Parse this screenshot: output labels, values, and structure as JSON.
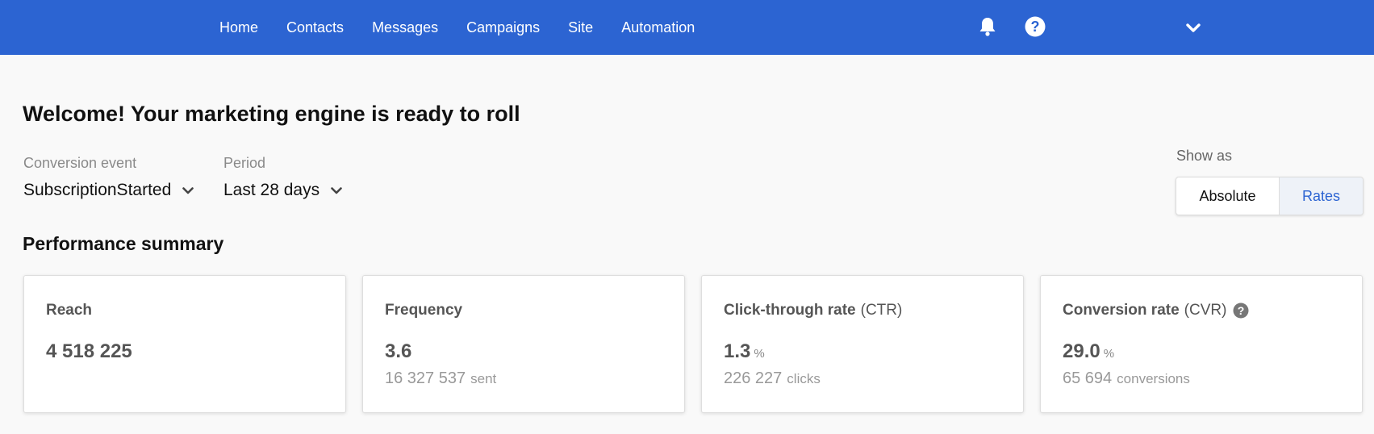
{
  "nav": {
    "items": [
      "Home",
      "Contacts",
      "Messages",
      "Campaigns",
      "Site",
      "Automation"
    ],
    "icons": [
      "bell-icon",
      "help-icon",
      "chevron-down-icon"
    ]
  },
  "page": {
    "title": "Welcome! Your marketing engine is ready to roll"
  },
  "filters": {
    "conversion": {
      "label": "Conversion event",
      "value": "SubscriptionStarted"
    },
    "period": {
      "label": "Period",
      "value": "Last 28 days"
    }
  },
  "show_as": {
    "label": "Show as",
    "options": [
      "Absolute",
      "Rates"
    ],
    "selected": "Rates"
  },
  "summary": {
    "title": "Performance summary",
    "cards": [
      {
        "title": "Reach",
        "abbr": "",
        "value": "4 518 225",
        "unit": "",
        "sub_value": "",
        "sub_suffix": ""
      },
      {
        "title": "Frequency",
        "abbr": "",
        "value": "3.6",
        "unit": "",
        "sub_value": "16 327 537",
        "sub_suffix": "sent"
      },
      {
        "title": "Click-through rate",
        "abbr": "(CTR)",
        "value": "1.3",
        "unit": "%",
        "sub_value": "226 227",
        "sub_suffix": "clicks"
      },
      {
        "title": "Conversion rate",
        "abbr": "(CVR)",
        "value": "29.0",
        "unit": "%",
        "sub_value": "65 694",
        "sub_suffix": "conversions"
      }
    ]
  },
  "colors": {
    "brand": "#2c64d2",
    "background": "#f9f9f9",
    "selected_segment": "#eef2f8"
  }
}
